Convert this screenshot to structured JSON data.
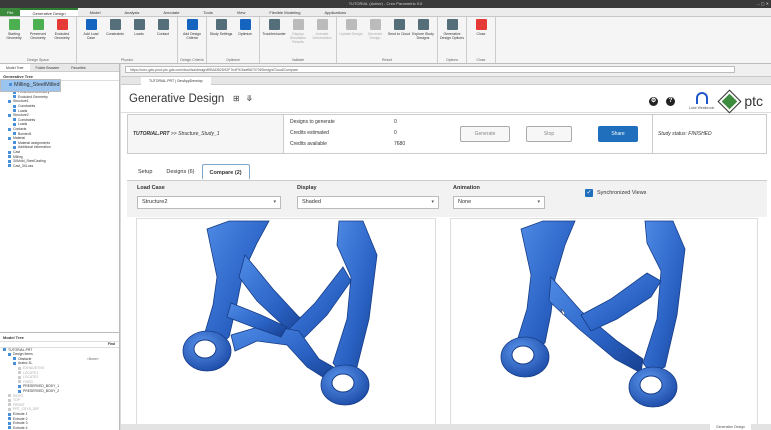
{
  "window": {
    "title": "TUTORIAL (Active) - Creo Parametric 9.0",
    "controls": "– ▢ ✕"
  },
  "ribbon_tabs": [
    "File",
    "Generative Design",
    "Model",
    "Analysis",
    "Annotate",
    "Tools",
    "View",
    "Flexible Modeling",
    "Applications"
  ],
  "ribbon": {
    "groups": [
      {
        "label": "Design Space",
        "buttons": [
          {
            "label": "Starting Geometry",
            "icon": "starting-geometry-icon",
            "color": "#4caf50"
          },
          {
            "label": "Preserved Geometry",
            "icon": "preserved-geometry-icon",
            "color": "#4caf50"
          },
          {
            "label": "Excluded Geometry",
            "icon": "excluded-geometry-icon",
            "color": "#e53935"
          }
        ]
      },
      {
        "label": "Physics",
        "buttons": [
          {
            "label": "Add Load Case",
            "icon": "load-case-icon",
            "color": "#1565c0"
          },
          {
            "label": "Constraints",
            "icon": "constraints-icon",
            "color": "#546e7a"
          },
          {
            "label": "Loads",
            "icon": "loads-icon",
            "color": "#546e7a"
          },
          {
            "label": "Contact",
            "icon": "contact-icon",
            "color": "#546e7a"
          }
        ]
      },
      {
        "label": "Design Criteria",
        "buttons": [
          {
            "label": "Add Design Criteria",
            "icon": "design-criteria-icon",
            "color": "#1565c0"
          }
        ]
      },
      {
        "label": "Optimize",
        "buttons": [
          {
            "label": "Study Settings",
            "icon": "study-settings-icon",
            "color": "#546e7a"
          },
          {
            "label": "Optimize",
            "icon": "optimize-icon",
            "color": "#1565c0"
          }
        ]
      },
      {
        "label": "Validate",
        "buttons": [
          {
            "label": "Troubleshooter",
            "icon": "troubleshooter-icon",
            "color": "#546e7a"
          },
          {
            "label": "Display Simulation Results",
            "icon": "simulation-results-icon",
            "color": "#bbb",
            "disabled": true
          },
          {
            "label": "Animate Deformation",
            "icon": "animate-icon",
            "color": "#bbb",
            "disabled": true
          }
        ]
      },
      {
        "label": "Result",
        "buttons": [
          {
            "label": "Update Design",
            "icon": "update-design-icon",
            "color": "#bbb",
            "disabled": true
          },
          {
            "label": "Generate Design",
            "icon": "generate-design-icon",
            "color": "#bbb",
            "disabled": true
          },
          {
            "label": "Send to Cloud",
            "icon": "cloud-icon",
            "color": "#546e7a"
          },
          {
            "label": "Explore Study Designs",
            "icon": "explore-icon",
            "color": "#546e7a"
          }
        ]
      },
      {
        "label": "Options",
        "buttons": [
          {
            "label": "Generative Design Options",
            "icon": "options-icon",
            "color": "#546e7a"
          }
        ]
      },
      {
        "label": "Close",
        "buttons": [
          {
            "label": "Close",
            "icon": "close-icon",
            "color": "#e53935"
          }
        ]
      }
    ]
  },
  "panel_tabs": [
    "Model Tree",
    "Folder Browser",
    "Favorites"
  ],
  "tree_top": {
    "title": "Generative Tree",
    "items": [
      {
        "t": "Design Space",
        "d": 1
      },
      {
        "t": "Starting Geometry",
        "d": 2
      },
      {
        "t": "Preserved Geometry",
        "d": 2
      },
      {
        "t": "Excluded Geometry",
        "d": 2
      },
      {
        "t": "Structure1",
        "d": 1
      },
      {
        "t": "Constraints",
        "d": 2
      },
      {
        "t": "Loads",
        "d": 2
      },
      {
        "t": "Structure2",
        "d": 1
      },
      {
        "t": "Constraints",
        "d": 2
      },
      {
        "t": "Loads",
        "d": 2
      },
      {
        "t": "Contacts",
        "d": 1
      },
      {
        "t": "Bonded1",
        "d": 2
      },
      {
        "t": "Material",
        "d": 1
      },
      {
        "t": "Material assignments",
        "d": 2
      },
      {
        "t": "Additional information",
        "d": 2
      },
      {
        "t": "Cast",
        "d": 1
      },
      {
        "t": "Milling",
        "d": 1
      },
      {
        "t": "3XMold_SteelCasting",
        "d": 1
      },
      {
        "t": "Milling_SteelMilled",
        "d": 1,
        "sel": true
      },
      {
        "t": "Cast_3XLoss",
        "d": 1
      }
    ]
  },
  "tree_bottom": {
    "title": "Model Tree",
    "filter": "Find",
    "items": [
      {
        "t": "TUTORIAL.PRT",
        "d": 0
      },
      {
        "t": "Design Items",
        "d": 1
      },
      {
        "t": "Obstacle",
        "d": 2,
        "v": "<None>"
      },
      {
        "t": "Arabic 3L",
        "d": 2
      },
      {
        "t": "EXHAUSTIVE",
        "d": 3,
        "dim": true
      },
      {
        "t": "LOCATE1",
        "d": 3,
        "dim": true
      },
      {
        "t": "LOCATE2",
        "d": 3,
        "dim": true
      },
      {
        "t": "FIXED",
        "d": 3,
        "dim": true
      },
      {
        "t": "PRESERVED_BODY_1",
        "d": 3
      },
      {
        "t": "PRESERVED_BODY_2",
        "d": 3
      },
      {
        "t": "RIGHT",
        "d": 1,
        "dim": true
      },
      {
        "t": "TOP",
        "d": 1,
        "dim": true
      },
      {
        "t": "FRONT",
        "d": 1,
        "dim": true
      },
      {
        "t": "PRT_CSYS_DEF",
        "d": 1,
        "dim": true
      },
      {
        "t": "Extrude 1",
        "d": 1
      },
      {
        "t": "Extrude 2",
        "d": 1
      },
      {
        "t": "Extrude 3",
        "d": 1
      },
      {
        "t": "Extrude 4",
        "d": 1
      }
    ]
  },
  "browser": {
    "url": "https://creo-gds-prod.ptc.gds.com/dsc/dsa/design/ff/BADB2D92F7e4F9/3aaf567070f/Design/Cloud/Compare",
    "doc_tab": "TUTORIAL.PRT | GenAppDevelop"
  },
  "gd": {
    "title": "Generative Design",
    "user_name": "Luke Westbrook",
    "brand": "ptc",
    "study_name": "TUTORIAL.PRT",
    "study_sep": " >> ",
    "study_study": "Structure_Study_1",
    "stats": [
      {
        "label": "Designs to generate",
        "value": "0"
      },
      {
        "label": "Credits estimated",
        "value": "0"
      },
      {
        "label": "Credits available",
        "value": "7680"
      }
    ],
    "generate_label": "Generate",
    "stop_label": "Stop",
    "share_label": "Share",
    "status": "Study status: FINISHED",
    "tabs": [
      "Setup",
      "Designs (6)",
      "Compare (2)"
    ],
    "active_tab": 2,
    "load_case_label": "Load Case",
    "load_case_value": "Structure2",
    "display_label": "Display",
    "display_value": "Shaded",
    "animation_label": "Animation",
    "animation_value": "None",
    "sync_label": "Synchronized Views",
    "zoom_label": "Generative Design"
  },
  "colors": {
    "accent": "#1f6fbd",
    "part": "#2f6fd1",
    "brand_green": "#3c8a3e"
  }
}
